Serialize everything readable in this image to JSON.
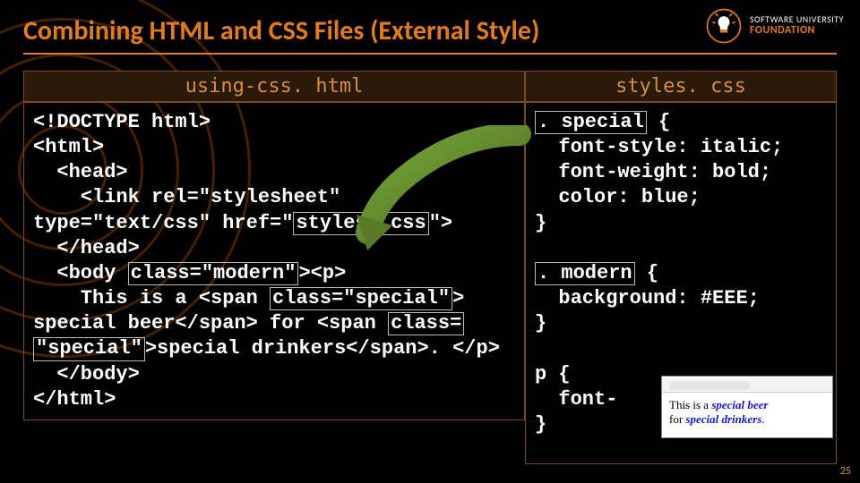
{
  "title": "Combining HTML and CSS Files (External Style)",
  "logo": {
    "line1": "SOFTWARE UNIVERSITY",
    "line2": "FOUNDATION"
  },
  "page_number": "25",
  "files": {
    "html": {
      "name": "using-css. html",
      "lines": {
        "l1": "<!DOCTYPE html>",
        "l2": "<html>",
        "l3": "  <head>",
        "l4a": "    <link rel=\"stylesheet\"",
        "l5a": "type=\"text/css\" href=\"",
        "l5hl": "styles. css",
        "l5b": "\">",
        "l6": "  </head>",
        "l7a": "  <body ",
        "l7hl": "class=\"modern\"",
        "l7b": "><p>",
        "l8a": "    This is a <span ",
        "l8hl": "class=\"special\"",
        "l8b": ">",
        "l9a": "special beer</span> for <span ",
        "l9hl": "class=",
        "l10hl": "\"special\"",
        "l10b": ">special drinkers</span>. </p>",
        "l11": "  </body>",
        "l12": "</html>"
      }
    },
    "css": {
      "name": "styles. css",
      "lines": {
        "a1hl": ". special",
        "a1b": " {",
        "a2": "  font-style: italic;",
        "a3": "  font-weight: bold;",
        "a4": "  color: blue;",
        "a5": "}",
        "b1hl": ". modern",
        "b1b": " {",
        "b2": "  background: #EEE;",
        "b3": "}",
        "c1": "p {",
        "c2": "  font-",
        "c3": "}"
      }
    }
  },
  "preview": {
    "text1": "This is a ",
    "special1": "special beer",
    "text2": "for ",
    "special2": "special drinkers",
    "punct": "."
  }
}
